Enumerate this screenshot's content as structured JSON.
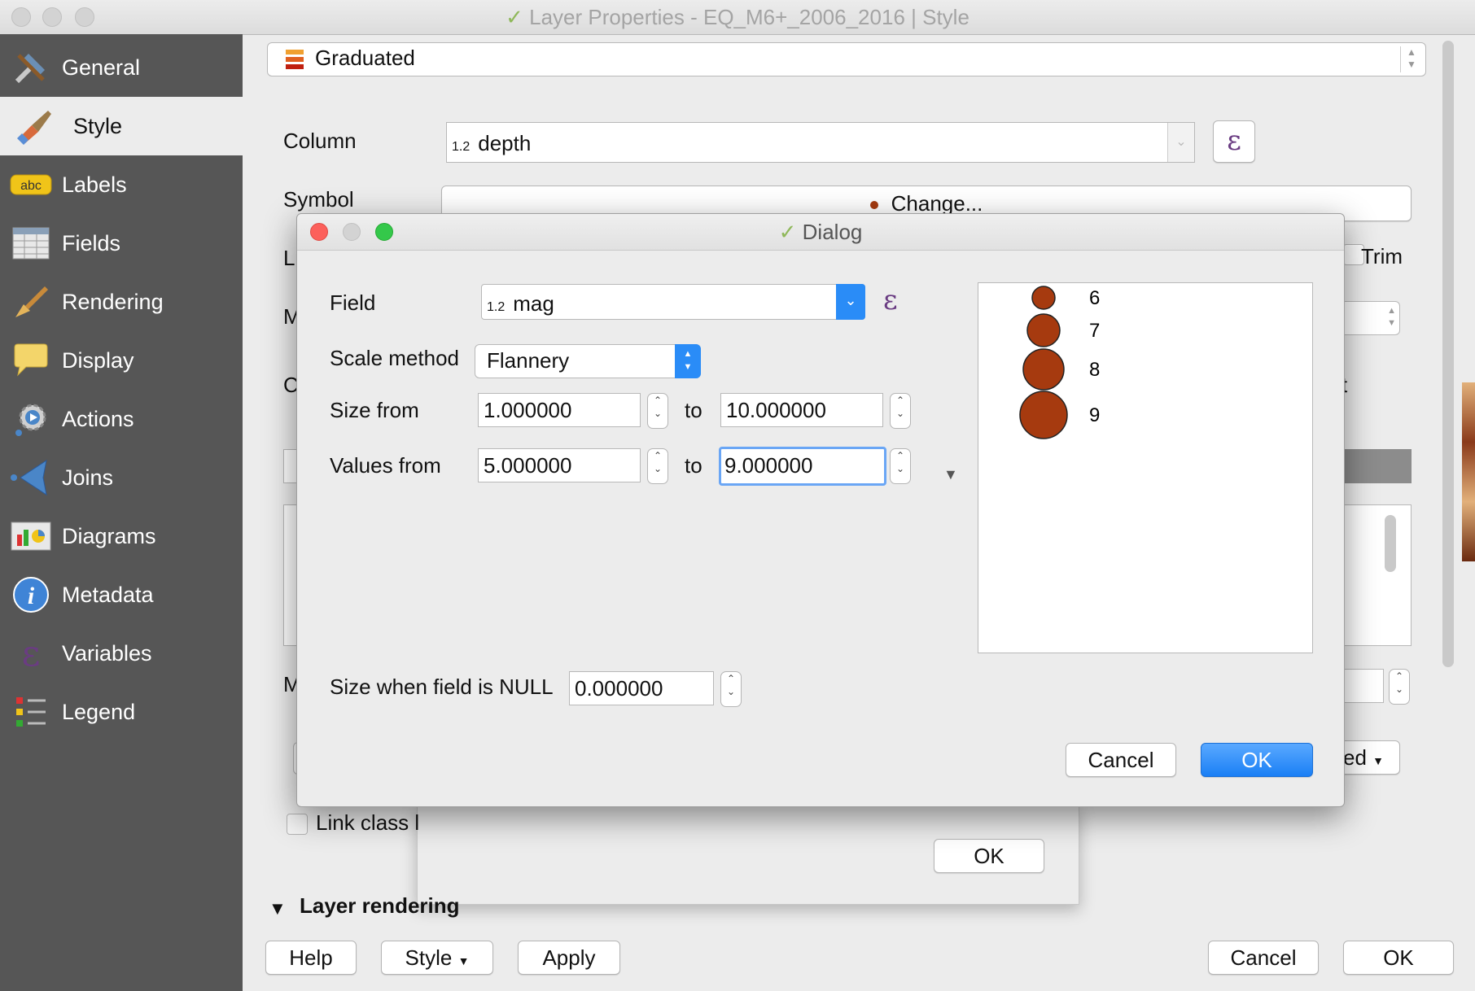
{
  "window": {
    "title": "Layer Properties - EQ_M6+_2006_2016 | Style"
  },
  "sidebar": {
    "items": [
      {
        "label": "General",
        "icon": "tools-icon"
      },
      {
        "label": "Style",
        "icon": "paintbrush-icon"
      },
      {
        "label": "Labels",
        "icon": "abc-label-icon"
      },
      {
        "label": "Fields",
        "icon": "table-icon"
      },
      {
        "label": "Rendering",
        "icon": "brush-icon"
      },
      {
        "label": "Display",
        "icon": "speech-bubble-icon"
      },
      {
        "label": "Actions",
        "icon": "gear-icon"
      },
      {
        "label": "Joins",
        "icon": "join-arrow-icon"
      },
      {
        "label": "Diagrams",
        "icon": "diagram-icon"
      },
      {
        "label": "Metadata",
        "icon": "info-icon"
      },
      {
        "label": "Variables",
        "icon": "epsilon-icon"
      },
      {
        "label": "Legend",
        "icon": "legend-icon"
      }
    ],
    "selected": "Style"
  },
  "style": {
    "renderer": "Graduated",
    "column_label": "Column",
    "column_type": "1.2",
    "column_value": "depth",
    "symbol_label": "Symbol",
    "change_button": "Change...",
    "trim_label": "Trim",
    "link_class_label": "Link class l",
    "partial_labels": {
      "l": "L",
      "m1": "M",
      "c": "C",
      "m2": "M",
      "t": "t",
      "ed": "ed"
    },
    "layer_rendering": "Layer rendering",
    "behind_ok": "OK"
  },
  "bottom_bar": {
    "help": "Help",
    "style": "Style",
    "apply": "Apply",
    "cancel": "Cancel",
    "ok": "OK"
  },
  "dialog": {
    "title": "Dialog",
    "field_label": "Field",
    "field_type": "1.2",
    "field_value": "mag",
    "scale_method_label": "Scale method",
    "scale_method_value": "Flannery",
    "size_from_label": "Size from",
    "size_from": "1.000000",
    "size_to_label": "to",
    "size_to": "10.000000",
    "values_from_label": "Values from",
    "values_from": "5.000000",
    "values_to_label": "to",
    "values_to": "9.000000",
    "null_size_label": "Size when field is NULL",
    "null_size": "0.000000",
    "cancel": "Cancel",
    "ok": "OK",
    "legend": [
      {
        "label": "6"
      },
      {
        "label": "7"
      },
      {
        "label": "8"
      },
      {
        "label": "9"
      }
    ],
    "symbol_color": "#a63a0f"
  },
  "colors": {
    "accent_blue": "#2a8cf7",
    "sidebar_bg": "#565656"
  }
}
